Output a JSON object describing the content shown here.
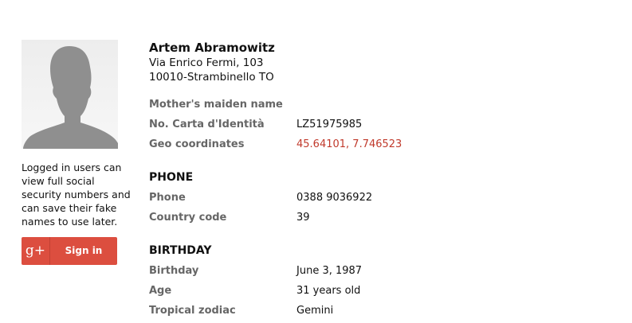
{
  "sidebar": {
    "note": "Logged in users can view full social security numbers and can save their fake names to use later.",
    "gplus_icon": "g+",
    "signin_label": "Sign in",
    "gplus_color": "#dc4e3f"
  },
  "person": {
    "name": "Artem Abramowitz",
    "address_line1": "Via Enrico Fermi, 103",
    "address_line2": "10010-Strambinello TO"
  },
  "identity": [
    {
      "label": "Mother's maiden name",
      "value": ""
    },
    {
      "label": "No. Carta d'Identità",
      "value": "LZ51975985"
    },
    {
      "label": "Geo coordinates",
      "value": "45.64101, 7.746523"
    }
  ],
  "phone_section": {
    "title": "PHONE",
    "rows": [
      {
        "label": "Phone",
        "value": "0388 9036922"
      },
      {
        "label": "Country code",
        "value": "39"
      }
    ]
  },
  "birthday_section": {
    "title": "BIRTHDAY",
    "rows": [
      {
        "label": "Birthday",
        "value": "June 3, 1987"
      },
      {
        "label": "Age",
        "value": "31 years old"
      },
      {
        "label": "Tropical zodiac",
        "value": "Gemini"
      }
    ]
  }
}
